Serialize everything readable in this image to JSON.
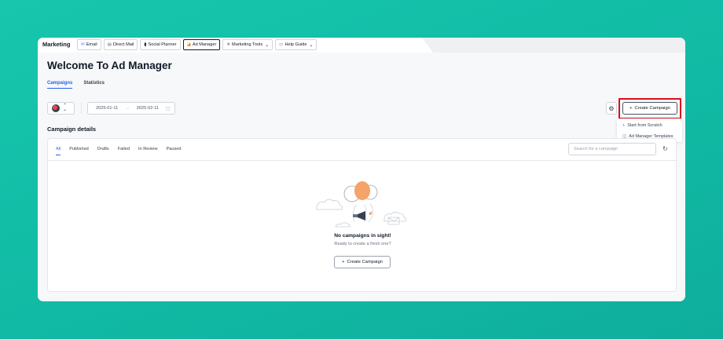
{
  "brand": "Marketing",
  "nav": {
    "tabs": [
      {
        "icon": "email-icon",
        "glyph": "✉",
        "label": "Email"
      },
      {
        "icon": "direct-mail-icon",
        "glyph": "▤",
        "label": "Direct Mail"
      },
      {
        "icon": "social-planner-icon",
        "glyph": "▮",
        "label": "Social Planner"
      },
      {
        "icon": "ad-manager-icon",
        "glyph": "◪",
        "label": "Ad Manager"
      },
      {
        "icon": "marketing-tools-icon",
        "glyph": "✕",
        "label": "Marketing Tools"
      },
      {
        "icon": "help-guide-icon",
        "glyph": "▭",
        "label": "Help Guide"
      }
    ]
  },
  "page": {
    "title": "Welcome To Ad Manager"
  },
  "subtabs": [
    "Campaigns",
    "Statistics"
  ],
  "date_range": {
    "start": "2025-01-11",
    "end": "2025-02-11"
  },
  "toolbar": {
    "create_label": "Create Campaign"
  },
  "dropdown": {
    "items": [
      "Start from Scratch",
      "Ad Manager Templates"
    ]
  },
  "section": {
    "title": "Campaign details"
  },
  "filters": [
    "All",
    "Published",
    "Drafts",
    "Failed",
    "In Review",
    "Paused"
  ],
  "search": {
    "placeholder": "Search for a campaign"
  },
  "empty": {
    "title": "No campaigns in sight!",
    "subtitle": "Ready to create a fresh one?",
    "button_label": "Create Campaign"
  },
  "colors": {
    "accent": "#2563eb",
    "highlight": "#d90f1b",
    "balloon": "#f4a36b"
  }
}
